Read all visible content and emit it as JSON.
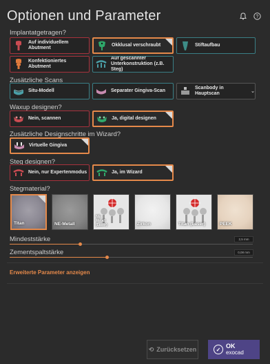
{
  "header": {
    "title": "Optionen und Parameter",
    "icons": [
      "bell-icon",
      "help-icon"
    ]
  },
  "sections": {
    "implant": "Implantatgetragen?",
    "scans": "Zusätzliche Scans",
    "waxup": "Waxup designen?",
    "wizard": "Zusätzliche Designschritte im Wizard?",
    "bar": "Steg designen?",
    "material": "Stegmaterial?"
  },
  "implant_options": [
    {
      "label": "Auf individuellem Abutment",
      "selected": false
    },
    {
      "label": "Okklusal verschraubt",
      "selected": true
    },
    {
      "label": "Stiftaufbau",
      "selected": false
    },
    {
      "label": "Konfektioniertes Abutment",
      "selected": false
    },
    {
      "label": "Auf gescannter Unterkonstruktion (z.B. Steg)",
      "selected": false
    }
  ],
  "scan_options": [
    {
      "label": "Situ-Modell",
      "selected": false
    },
    {
      "label": "Separater Gingiva-Scan",
      "selected": false
    },
    {
      "label": "Scanbody in Hauptscan",
      "selected": false,
      "dropdown": true
    }
  ],
  "waxup_options": [
    {
      "label": "Nein, scannen",
      "selected": false
    },
    {
      "label": "Ja, digital designen",
      "selected": true
    }
  ],
  "wizard_options": [
    {
      "label": "Virtuelle Gingiva",
      "selected": true
    }
  ],
  "bar_options": [
    {
      "label": "Nein, nur Expertenmodus",
      "selected": false
    },
    {
      "label": "Ja, im Wizard",
      "selected": true
    }
  ],
  "materials": [
    {
      "label": "Titan",
      "selected": true,
      "color": "#8e8b96"
    },
    {
      "label": "NE-Metall",
      "selected": false,
      "color": "#8c8c8c"
    },
    {
      "label": "NE-Metall (Laser)",
      "selected": false,
      "color": "#e8e8e8"
    },
    {
      "label": "Zirkon",
      "selected": false,
      "color": "#e9e9e9"
    },
    {
      "label": "Titan (Laser)",
      "selected": false,
      "color": "#e8e8e8"
    },
    {
      "label": "PEEK",
      "selected": false,
      "color": "#e8d7c4"
    }
  ],
  "sliders": [
    {
      "label": "Mindeststärke",
      "value": "2,5 mm",
      "level": 0.29
    },
    {
      "label": "Zementspaltstärke",
      "value": "0,08 mm",
      "level": 0.4
    }
  ],
  "advanced_link": "Erweiterte Parameter anzeigen",
  "footer": {
    "reset": "Zurücksetzen",
    "ok": "OK",
    "brand": "exocad"
  },
  "colors": {
    "accent": "#e5894a",
    "red_border": "#a8323d",
    "teal_border": "#3a7f86",
    "ok_bg": "#4e4486"
  }
}
